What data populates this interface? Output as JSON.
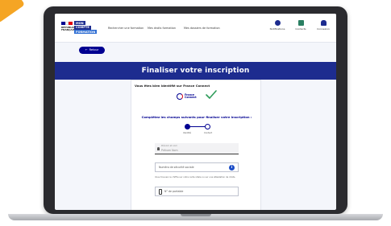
{
  "header": {
    "republic_lines": [
      "RÉPUBLIQUE",
      "FRANÇAISE"
    ],
    "logo_lines": [
      "MON",
      "COMPTE",
      "FORMATION"
    ],
    "nav": [
      "Rechercher une formation",
      "Mes droits formation",
      "Mes dossiers de formation"
    ],
    "icons": [
      {
        "label": "Notifications",
        "icon": "bell-icon"
      },
      {
        "label": "Contacts",
        "icon": "contact-icon"
      },
      {
        "label": "Connexion",
        "icon": "user-icon"
      }
    ]
  },
  "back_button": "Retour",
  "hero": {
    "title": "Finaliser votre inscription"
  },
  "card": {
    "identified_text": "Vous êtes bien identifié sur France Connect",
    "fc_logo_lines": [
      "France",
      "Connect"
    ],
    "complete_text": "Complétez les champs suivants pour finaliser votre inscription :",
    "steps": [
      "Identité",
      "Contact"
    ],
    "name_field": {
      "label": "Prénom et nom",
      "value": "Prénom Nom"
    },
    "ssn_field": {
      "placeholder": "Numéro de sécurité sociale"
    },
    "help_text": "Vous trouvez ce chiffre sur votre carte vitale ou sur une attestation de droits.",
    "phone_field": {
      "placeholder": "N° de portable"
    }
  },
  "colors": {
    "brand_blue": "#000091",
    "hero_blue": "#1d2c8f",
    "accent_orange": "#f5a524"
  }
}
